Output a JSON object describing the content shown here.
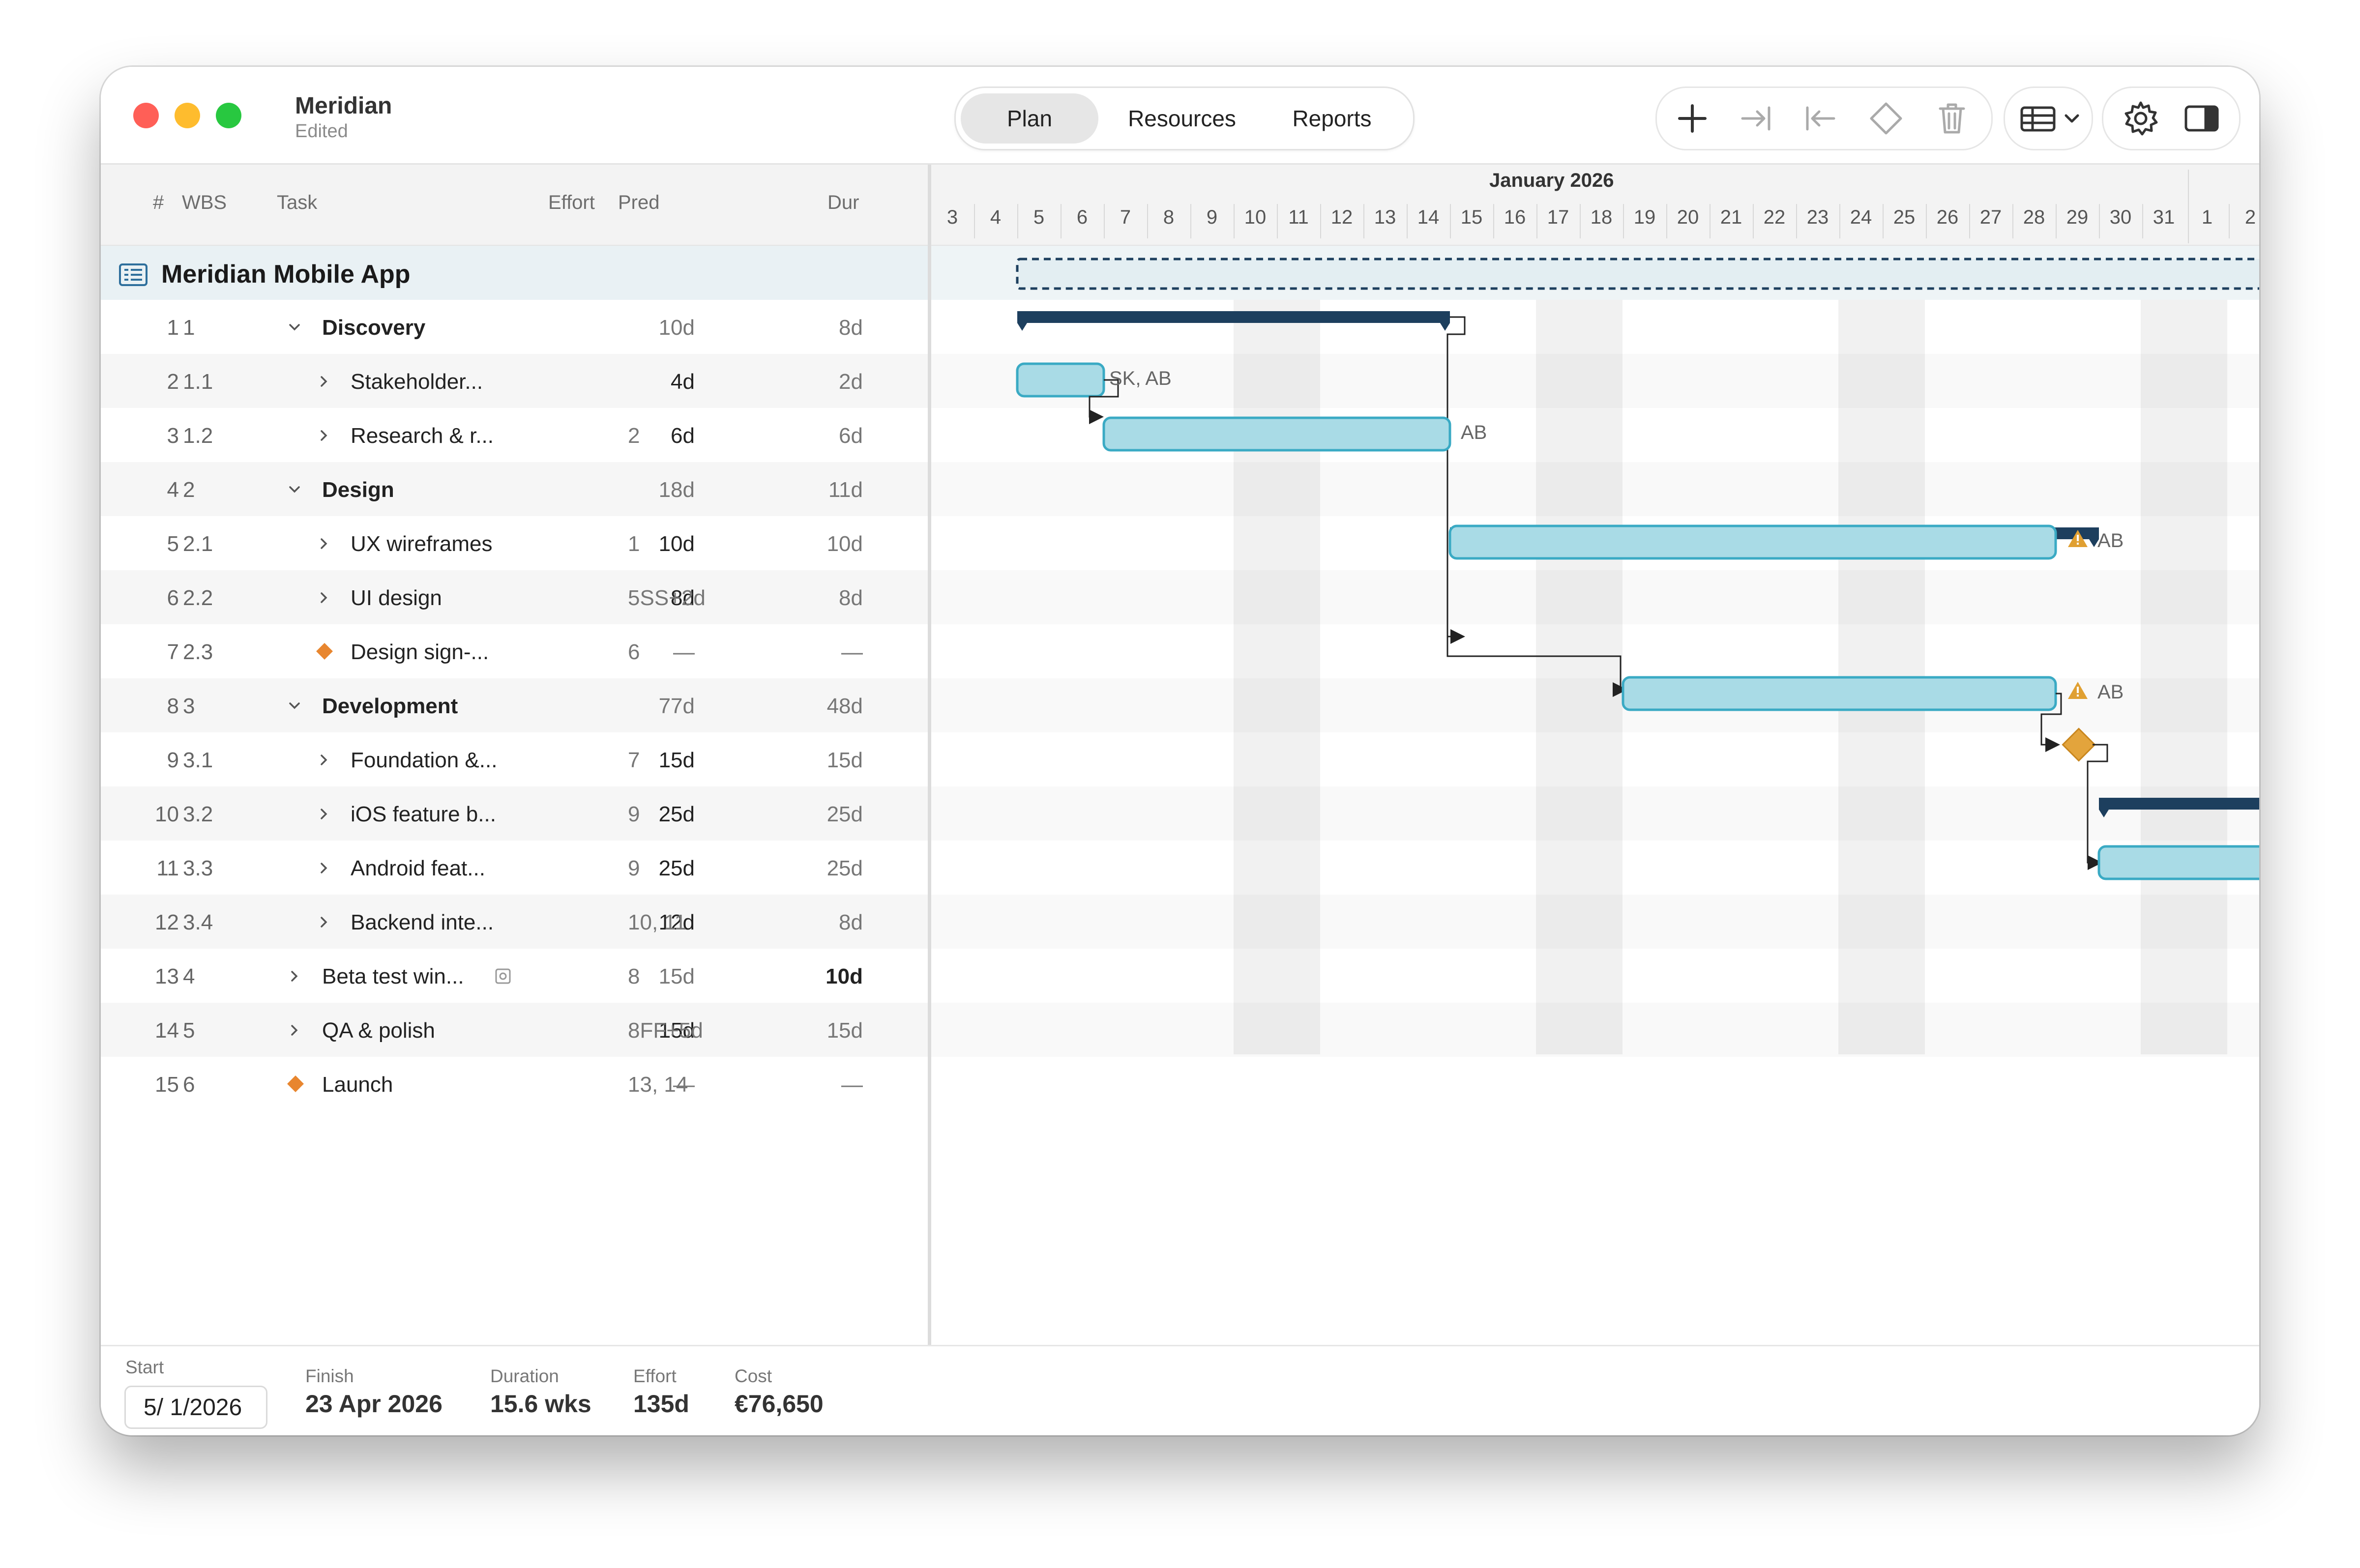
{
  "window": {
    "title": "Meridian",
    "subtitle": "Edited"
  },
  "view_tabs": [
    {
      "label": "Plan",
      "selected": true
    },
    {
      "label": "Resources",
      "selected": false
    },
    {
      "label": "Reports",
      "selected": false
    }
  ],
  "toolbar_icons": [
    "plus-icon",
    "indent-icon",
    "outdent-icon",
    "milestone-icon",
    "trash-icon",
    "table-view-icon",
    "chevron-down-icon",
    "gear-icon",
    "sidebar-icon"
  ],
  "table": {
    "columns": {
      "num": "#",
      "wbs": "WBS",
      "task": "Task",
      "effort": "Effort",
      "pred": "Pred",
      "dur": "Dur"
    },
    "project": {
      "name": "Meridian Mobile App"
    },
    "rows": [
      {
        "num": "1",
        "wbs": "1",
        "task": "Discovery",
        "effort": "10d",
        "pred": "",
        "dur": "8d",
        "kind": "summary-open"
      },
      {
        "num": "2",
        "wbs": "1.1",
        "task": "Stakeholder...",
        "effort": "4d",
        "pred": "",
        "dur": "2d",
        "kind": "task"
      },
      {
        "num": "3",
        "wbs": "1.2",
        "task": "Research & r...",
        "effort": "6d",
        "pred": "2",
        "dur": "6d",
        "kind": "task"
      },
      {
        "num": "4",
        "wbs": "2",
        "task": "Design",
        "effort": "18d",
        "pred": "",
        "dur": "11d",
        "kind": "summary-open"
      },
      {
        "num": "5",
        "wbs": "2.1",
        "task": "UX wireframes",
        "effort": "10d",
        "pred": "1",
        "dur": "10d",
        "kind": "task"
      },
      {
        "num": "6",
        "wbs": "2.2",
        "task": "UI design",
        "effort": "8d",
        "pred": "5SS+2d",
        "dur": "8d",
        "kind": "task"
      },
      {
        "num": "7",
        "wbs": "2.3",
        "task": "Design sign-...",
        "effort": "—",
        "pred": "6",
        "dur": "—",
        "kind": "milestone"
      },
      {
        "num": "8",
        "wbs": "3",
        "task": "Development",
        "effort": "77d",
        "pred": "",
        "dur": "48d",
        "kind": "summary-open"
      },
      {
        "num": "9",
        "wbs": "3.1",
        "task": "Foundation &...",
        "effort": "15d",
        "pred": "7",
        "dur": "15d",
        "kind": "task"
      },
      {
        "num": "10",
        "wbs": "3.2",
        "task": "iOS feature b...",
        "effort": "25d",
        "pred": "9",
        "dur": "25d",
        "kind": "task"
      },
      {
        "num": "11",
        "wbs": "3.3",
        "task": "Android feat...",
        "effort": "25d",
        "pred": "9",
        "dur": "25d",
        "kind": "task"
      },
      {
        "num": "12",
        "wbs": "3.4",
        "task": "Backend inte...",
        "effort": "12d",
        "pred": "10, 11",
        "dur": "8d",
        "kind": "task"
      },
      {
        "num": "13",
        "wbs": "4",
        "task": "Beta test win...",
        "effort": "15d",
        "pred": "8",
        "dur": "10d",
        "kind": "summary-closed"
      },
      {
        "num": "14",
        "wbs": "5",
        "task": "QA & polish",
        "effort": "15d",
        "pred": "8FF+5d",
        "dur": "15d",
        "kind": "summary-closed"
      },
      {
        "num": "15",
        "wbs": "6",
        "task": "Launch",
        "effort": "—",
        "pred": "13, 14",
        "dur": "—",
        "kind": "milestone-top"
      }
    ]
  },
  "gantt": {
    "month": "January 2026",
    "days": [
      "3",
      "4",
      "5",
      "6",
      "7",
      "8",
      "9",
      "10",
      "11",
      "12",
      "13",
      "14",
      "15",
      "16",
      "17",
      "18",
      "19",
      "20",
      "21",
      "22",
      "23",
      "24",
      "25",
      "26",
      "27",
      "28",
      "29",
      "30",
      "31",
      "1",
      "2"
    ],
    "resource_labels": {
      "stakeholder": "SK, AB",
      "research": "AB",
      "ux": "AB",
      "ui": "AB"
    },
    "colors": {
      "task_fill": "#a9dbe6",
      "task_border": "#3aaac4",
      "summary": "#1d3f5e",
      "milestone": "#e3a43c",
      "warning": "#e0a032"
    }
  },
  "footer": {
    "start_label": "Start",
    "start_value": "5/ 1/2026",
    "finish_label": "Finish",
    "finish_value": "23 Apr 2026",
    "duration_label": "Duration",
    "duration_value": "15.6 wks",
    "effort_label": "Effort",
    "effort_value": "135d",
    "cost_label": "Cost",
    "cost_value": "€76,650"
  }
}
